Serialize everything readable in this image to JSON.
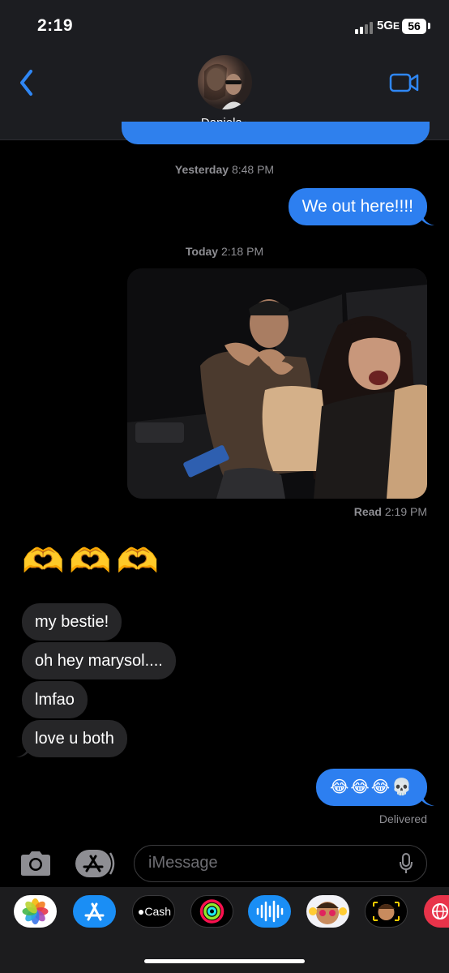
{
  "status": {
    "time": "2:19",
    "network": "5G",
    "network_suffix": "E",
    "battery": "56"
  },
  "header": {
    "contact_name": "Daniela",
    "chevron": "›"
  },
  "thread": {
    "timestamp_1": {
      "day": "Yesterday",
      "time": "8:48 PM"
    },
    "msg_out_1": "We out here!!!!",
    "timestamp_2": {
      "day": "Today",
      "time": "2:18 PM"
    },
    "read_receipt": {
      "label": "Read",
      "time": "2:19 PM"
    },
    "emoji_reaction": "🫶🫶🫶",
    "incoming": [
      "my bestie!",
      "oh hey marysol....",
      "lmfao",
      "love u both"
    ],
    "msg_out_2": "😂😂😂💀",
    "delivered": "Delivered"
  },
  "input": {
    "placeholder": "iMessage"
  },
  "app_drawer": {
    "apps": [
      {
        "name": "photos",
        "label": ""
      },
      {
        "name": "app-store",
        "label": ""
      },
      {
        "name": "apple-cash",
        "label": "Cash"
      },
      {
        "name": "fitness",
        "label": ""
      },
      {
        "name": "audio-message",
        "label": ""
      },
      {
        "name": "memoji-stickers",
        "label": ""
      },
      {
        "name": "animoji",
        "label": ""
      },
      {
        "name": "web-search",
        "label": ""
      }
    ]
  },
  "colors": {
    "outgoing": "#2d7ff0",
    "incoming": "#262628",
    "accent": "#2f87f5",
    "background": "#000000"
  }
}
